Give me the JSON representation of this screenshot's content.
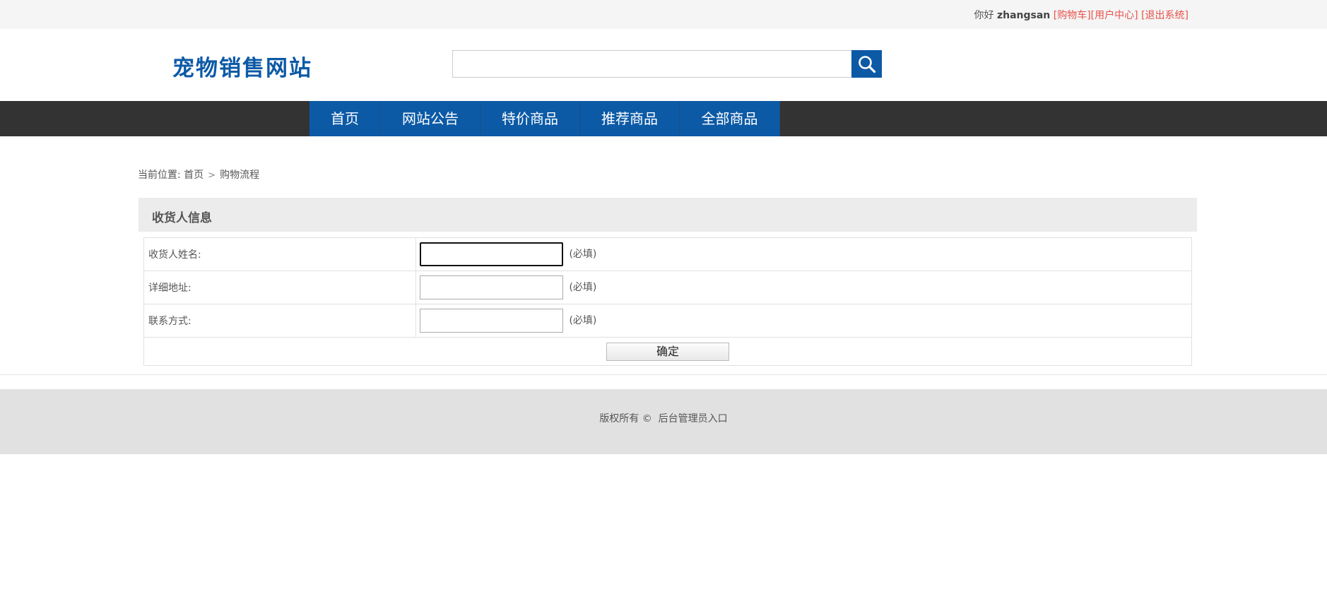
{
  "topbar": {
    "greeting": "你好",
    "username": "zhangsan",
    "cart_link": "[购物车]",
    "user_center_link": "[用户中心]",
    "logout_link": "[退出系统]"
  },
  "header": {
    "logo": "宠物销售网站",
    "search_value": ""
  },
  "nav": {
    "items": [
      {
        "label": "首页"
      },
      {
        "label": "网站公告"
      },
      {
        "label": "特价商品"
      },
      {
        "label": "推荐商品"
      },
      {
        "label": "全部商品"
      }
    ]
  },
  "breadcrumb": {
    "prefix": "当前位置:",
    "home": "首页",
    "separator": ">",
    "current": "购物流程"
  },
  "panel": {
    "title": "收货人信息",
    "rows": [
      {
        "label": "收货人姓名:",
        "required": "(必填)",
        "value": ""
      },
      {
        "label": "详细地址:",
        "required": "(必填)",
        "value": ""
      },
      {
        "label": "联系方式:",
        "required": "(必填)",
        "value": ""
      }
    ],
    "submit_label": "确定"
  },
  "footer": {
    "copyright": "版权所有 ©",
    "admin_link": "后台管理员入口"
  },
  "colors": {
    "brand_blue": "#0c5aa6",
    "nav_bar": "#333333",
    "link_red": "#e8514a"
  }
}
